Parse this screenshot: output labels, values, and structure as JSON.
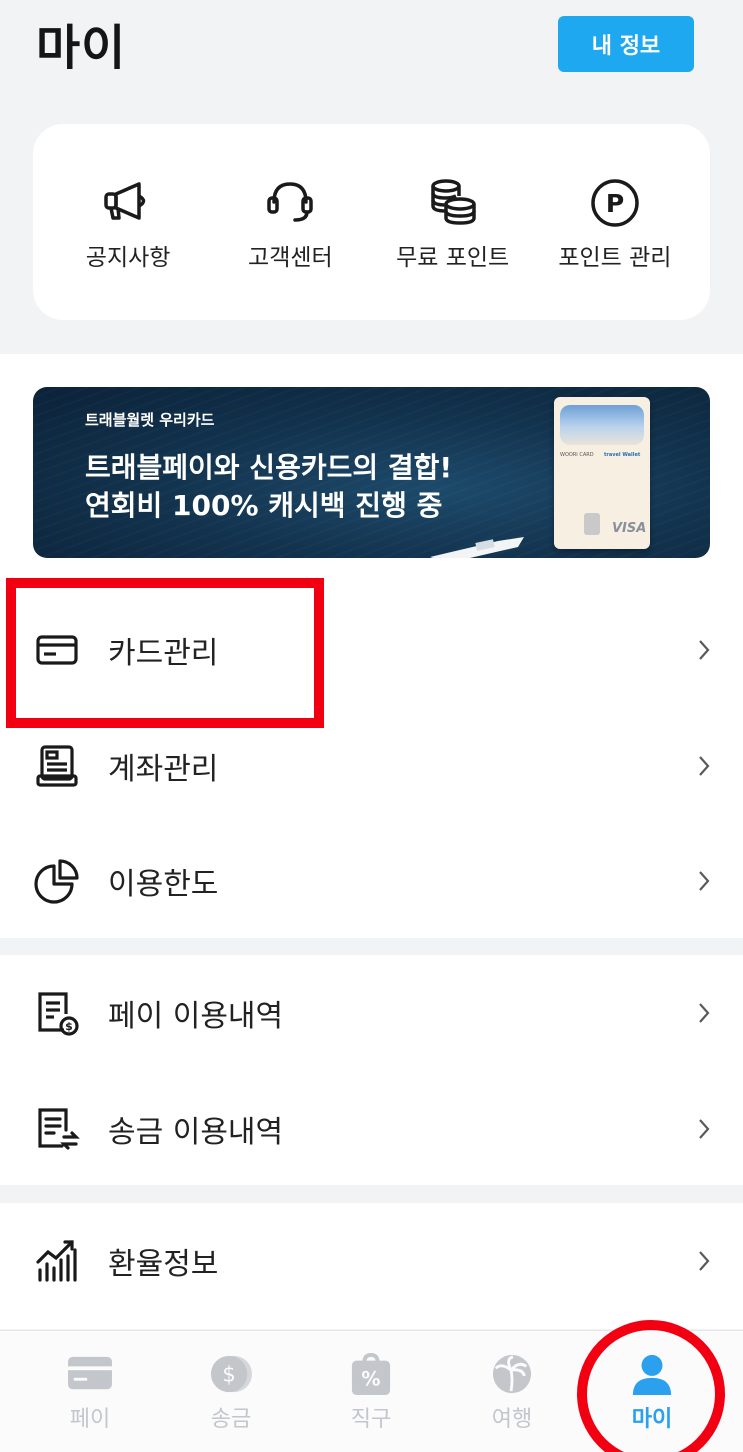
{
  "header": {
    "title": "마이",
    "my_info_button": "내 정보"
  },
  "quick_menu": [
    {
      "label": "공지사항",
      "icon": "megaphone-icon"
    },
    {
      "label": "고객센터",
      "icon": "headset-icon"
    },
    {
      "label": "무료 포인트",
      "icon": "coins-icon"
    },
    {
      "label": "포인트 관리",
      "icon": "point-p-icon"
    }
  ],
  "banner": {
    "subtitle": "트래블월렛 우리카드",
    "title_line1": "트래블페이와 신용카드의 결합!",
    "title_line2": "연회비 100% 캐시백 진행 중",
    "card_brand": "VISA"
  },
  "menu_groups": [
    [
      {
        "label": "카드관리",
        "icon": "card-icon"
      },
      {
        "label": "계좌관리",
        "icon": "account-icon"
      },
      {
        "label": "이용한도",
        "icon": "pie-chart-icon"
      }
    ],
    [
      {
        "label": "페이 이용내역",
        "icon": "pay-history-icon"
      },
      {
        "label": "송금 이용내역",
        "icon": "remit-history-icon"
      }
    ],
    [
      {
        "label": "환율정보",
        "icon": "exchange-rate-chart-icon"
      }
    ]
  ],
  "tabbar": [
    {
      "label": "페이",
      "icon": "card-tab-icon",
      "active": false
    },
    {
      "label": "송금",
      "icon": "dollar-coin-icon",
      "active": false
    },
    {
      "label": "직구",
      "icon": "shopping-bag-icon",
      "active": false
    },
    {
      "label": "여행",
      "icon": "palm-tree-icon",
      "active": false
    },
    {
      "label": "마이",
      "icon": "person-icon",
      "active": true
    }
  ],
  "colors": {
    "accent": "#1ea8f0",
    "annotation_red": "#f20012",
    "inactive_tab": "#c3c6cb",
    "active_tab": "#2ba0ee"
  }
}
